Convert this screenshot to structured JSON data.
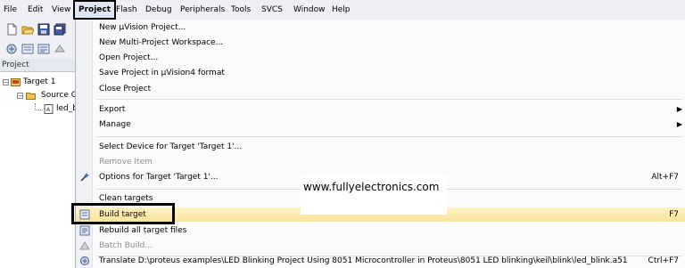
{
  "menubar": {
    "items": [
      "File",
      "Edit",
      "View",
      "Project",
      "Flash",
      "Debug",
      "Peripherals",
      "Tools",
      "SVCS",
      "Window",
      "Help"
    ],
    "active": "Project"
  },
  "toolbar": {
    "icons": [
      "new-file-icon",
      "open-folder-icon",
      "save-icon",
      "save-all-icon",
      "translate-icon",
      "build-icon",
      "rebuild-icon",
      "batch-build-icon"
    ]
  },
  "project_panel": {
    "title": "Project",
    "tree": [
      {
        "label": "Target 1",
        "level": 0,
        "expander": "−"
      },
      {
        "label": "Source G",
        "level": 1,
        "expander": "−"
      },
      {
        "label": "led_b",
        "level": 2,
        "expander": ""
      }
    ]
  },
  "menu": {
    "items": [
      {
        "label": "New µVision Project...",
        "shortcut": "",
        "disabled": false,
        "icon": "",
        "submenu": false
      },
      {
        "label": "New Multi-Project Workspace...",
        "shortcut": "",
        "disabled": false,
        "icon": "",
        "submenu": false
      },
      {
        "label": "Open Project...",
        "shortcut": "",
        "disabled": false,
        "icon": "",
        "submenu": false
      },
      {
        "label": "Save Project in µVision4 format",
        "shortcut": "",
        "disabled": false,
        "icon": "",
        "submenu": false
      },
      {
        "label": "Close Project",
        "shortcut": "",
        "disabled": false,
        "icon": "",
        "submenu": false
      },
      {
        "label": "Export",
        "shortcut": "",
        "disabled": false,
        "icon": "",
        "submenu": true
      },
      {
        "label": "Manage",
        "shortcut": "",
        "disabled": false,
        "icon": "",
        "submenu": true
      },
      {
        "label": "Select Device for Target 'Target 1'...",
        "shortcut": "",
        "disabled": false,
        "icon": "",
        "submenu": false
      },
      {
        "label": "Remove Item",
        "shortcut": "",
        "disabled": true,
        "icon": "",
        "submenu": false
      },
      {
        "label": "Options for Target 'Target 1'...",
        "shortcut": "Alt+F7",
        "disabled": false,
        "icon": "options-wand-icon",
        "submenu": false
      },
      {
        "label": "Clean targets",
        "shortcut": "",
        "disabled": false,
        "icon": "",
        "submenu": false
      },
      {
        "label": "Build target",
        "shortcut": "F7",
        "disabled": false,
        "icon": "build-icon",
        "submenu": false
      },
      {
        "label": "Rebuild all target files",
        "shortcut": "",
        "disabled": false,
        "icon": "rebuild-icon",
        "submenu": false
      },
      {
        "label": "Batch Build...",
        "shortcut": "",
        "disabled": true,
        "icon": "batch-build-icon",
        "submenu": false
      },
      {
        "label": "Translate D:\\proteus examples\\LED Blinking Project Using 8051 Microcontroller in Proteus\\8051 LED blinking\\keil\\blink\\led_blink.a51",
        "shortcut": "Ctrl+F7",
        "disabled": false,
        "icon": "translate-icon",
        "submenu": false
      }
    ],
    "highlighted": "Build target"
  },
  "watermark": {
    "text": "www.fullyelectronics.com"
  },
  "colors": {
    "highlight": "#fbe39a",
    "menubar": "#eef0f4",
    "callout": "#000000"
  }
}
